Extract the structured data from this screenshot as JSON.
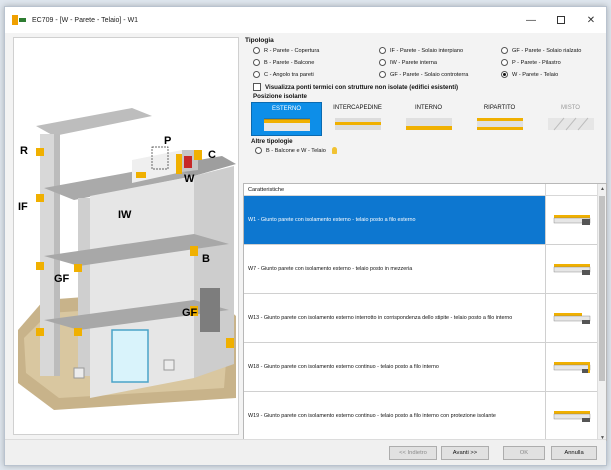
{
  "window": {
    "title": "EC709 - [W - Parete - Telaio] - W1",
    "controls": [
      "minimize",
      "maximize",
      "close"
    ]
  },
  "illustration": {
    "labels": [
      "R",
      "P",
      "C",
      "W",
      "IF",
      "IW",
      "B",
      "GF",
      "GF"
    ]
  },
  "tipologia": {
    "title": "Tipologia",
    "options": [
      {
        "label": "R - Parete - Copertura",
        "selected": false
      },
      {
        "label": "IF - Parete - Solaio interpiano",
        "selected": false
      },
      {
        "label": "GF - Parete - Solaio rialzato",
        "selected": false
      },
      {
        "label": "B - Parete - Balcone",
        "selected": false
      },
      {
        "label": "IW - Parete interna",
        "selected": false
      },
      {
        "label": "P - Parete - Pilastro",
        "selected": false
      },
      {
        "label": "C - Angolo tra pareti",
        "selected": false
      },
      {
        "label": "GF - Parete - Solaio controterra",
        "selected": false
      },
      {
        "label": "W - Parete - Telaio",
        "selected": true
      }
    ],
    "checkbox_label": "Visualizza ponti termici con strutture non isolate (edifici esistenti)",
    "checkbox_checked": false
  },
  "posizione": {
    "title": "Posizione isolante",
    "options": [
      {
        "label": "ESTERNO",
        "selected": true,
        "disabled": false
      },
      {
        "label": "INTERCAPEDINE",
        "selected": false,
        "disabled": false
      },
      {
        "label": "INTERNO",
        "selected": false,
        "disabled": false
      },
      {
        "label": "RIPARTITO",
        "selected": false,
        "disabled": false
      },
      {
        "label": "MISTO",
        "selected": false,
        "disabled": true
      }
    ]
  },
  "altre": {
    "title": "Altre tipologie",
    "option": "B - Balcone  e  W - Telaio",
    "icon": "lightbulb-icon"
  },
  "list": {
    "header": "Caratteristiche",
    "rows": [
      {
        "text": "W1 - Giunto parete con isolamento esterno - telaio posto a filo esterno",
        "selected": true
      },
      {
        "text": "W7 - Giunto parete con isolamento esterno - telaio posto in mezzeria",
        "selected": false
      },
      {
        "text": "W13 - Giunto parete con isolamento esterno interrotto in corrispondenza dello stipite - telaio posto a filo interno",
        "selected": false
      },
      {
        "text": "W18 - Giunto parete con isolamento esterno continuo - telaio posto a filo interno",
        "selected": false
      },
      {
        "text": "W19 - Giunto parete con isolamento esterno continuo - telaio posto a filo interno con protezione isolante",
        "selected": false
      }
    ]
  },
  "footer": {
    "back": "<< Indietro",
    "next": "Avanti >>",
    "ok": "OK",
    "cancel": "Annulla"
  },
  "colors": {
    "accent": "#0d77d0",
    "insulation": "#f0b000"
  }
}
